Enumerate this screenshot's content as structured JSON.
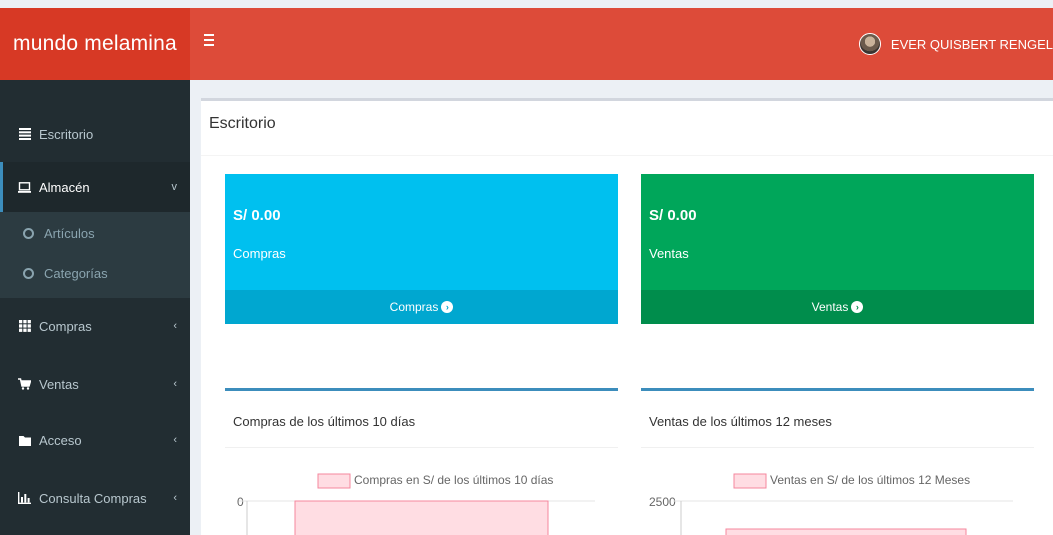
{
  "header": {
    "logo": "mundo melamina",
    "user_name": "EVER QUISBERT RENGEL"
  },
  "sidebar": {
    "items": [
      {
        "label": "Escritorio",
        "icon": "dashboard-icon"
      },
      {
        "label": "Almacén",
        "icon": "laptop-icon",
        "caret": "v"
      },
      {
        "label": "Artículos"
      },
      {
        "label": "Categorías"
      },
      {
        "label": "Compras",
        "icon": "grid-icon",
        "caret": "‹"
      },
      {
        "label": "Ventas",
        "icon": "cart-icon",
        "caret": "‹"
      },
      {
        "label": "Acceso",
        "icon": "folder-icon",
        "caret": "‹"
      },
      {
        "label": "Consulta Compras",
        "icon": "bar-chart-icon",
        "caret": "‹"
      }
    ]
  },
  "main": {
    "title": "Escritorio",
    "boxes": [
      {
        "amount": "S/ 0.00",
        "label": "Compras",
        "footer": "Compras",
        "color": "#00c0ef",
        "footer_color": "#00a7d0"
      },
      {
        "amount": "S/ 0.00",
        "label": "Ventas",
        "footer": "Ventas",
        "color": "#00a65a",
        "footer_color": "#008d4c"
      }
    ],
    "charts": [
      {
        "title": "Compras de los últimos 10 días"
      },
      {
        "title": "Ventas de los últimos 12 meses"
      }
    ]
  },
  "chart_data": [
    {
      "type": "bar",
      "title": "Compras de los últimos 10 días",
      "series": [
        {
          "name": "Compras en S/ de los últimos 10 días",
          "values": [
            0
          ]
        }
      ],
      "ytick_labels": [
        "0"
      ],
      "colors": {
        "fill": "#ffdde3",
        "stroke": "#f4879e"
      }
    },
    {
      "type": "bar",
      "title": "Ventas de los últimos 12 meses",
      "series": [
        {
          "name": "Ventas en S/ de los últimos 12 Meses",
          "values": []
        }
      ],
      "ytick_labels": [
        "2500"
      ],
      "colors": {
        "fill": "#ffdde3",
        "stroke": "#f4879e"
      }
    }
  ]
}
